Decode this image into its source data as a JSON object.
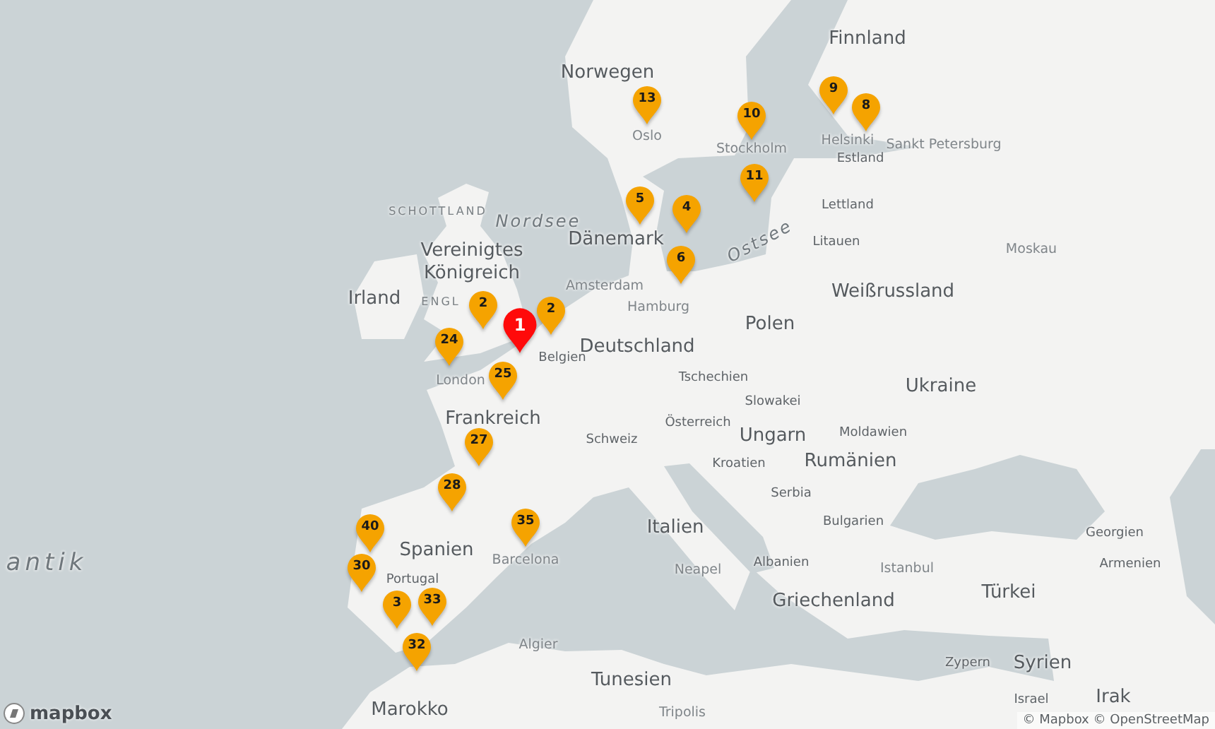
{
  "map": {
    "labels": [
      {
        "text": "Finnland",
        "kind": "country"
      },
      {
        "text": "Norwegen",
        "kind": "country"
      },
      {
        "text": "Oslo",
        "kind": "city"
      },
      {
        "text": "Stockholm",
        "kind": "city"
      },
      {
        "text": "Helsinki",
        "kind": "city"
      },
      {
        "text": "Sankt Petersburg",
        "kind": "city"
      },
      {
        "text": "Estland",
        "kind": "minor"
      },
      {
        "text": "Lettland",
        "kind": "minor"
      },
      {
        "text": "Litauen",
        "kind": "minor"
      },
      {
        "text": "Moskau",
        "kind": "city"
      },
      {
        "text": "SCHOTTLAND",
        "kind": "region"
      },
      {
        "text": "Nordsee",
        "kind": "sea"
      },
      {
        "text": "Ostsee",
        "kind": "sea"
      },
      {
        "text": "Dänemark",
        "kind": "country"
      },
      {
        "text": "Vereinigtes Königreich",
        "kind": "country"
      },
      {
        "text": "Irland",
        "kind": "country"
      },
      {
        "text": "ENGL",
        "kind": "region"
      },
      {
        "text": "Amsterdam",
        "kind": "city"
      },
      {
        "text": "Hamburg",
        "kind": "city"
      },
      {
        "text": "London",
        "kind": "city"
      },
      {
        "text": "Polen",
        "kind": "country"
      },
      {
        "text": "Weißrussland",
        "kind": "country"
      },
      {
        "text": "Deutschland",
        "kind": "country"
      },
      {
        "text": "Belgien",
        "kind": "minor"
      },
      {
        "text": "Tschechien",
        "kind": "minor"
      },
      {
        "text": "Ukraine",
        "kind": "country"
      },
      {
        "text": "Slowakei",
        "kind": "minor"
      },
      {
        "text": "Frankreich",
        "kind": "country"
      },
      {
        "text": "Österreich",
        "kind": "minor"
      },
      {
        "text": "Moldawien",
        "kind": "minor"
      },
      {
        "text": "Schweiz",
        "kind": "minor"
      },
      {
        "text": "Ungarn",
        "kind": "country"
      },
      {
        "text": "Rumänien",
        "kind": "country"
      },
      {
        "text": "Kroatien",
        "kind": "minor"
      },
      {
        "text": "Serbia",
        "kind": "minor"
      },
      {
        "text": "Bulgarien",
        "kind": "minor"
      },
      {
        "text": "Italien",
        "kind": "country"
      },
      {
        "text": "Spanien",
        "kind": "country"
      },
      {
        "text": "Georgien",
        "kind": "minor"
      },
      {
        "text": "antik",
        "kind": "ocean"
      },
      {
        "text": "Barcelona",
        "kind": "city"
      },
      {
        "text": "Albanien",
        "kind": "minor"
      },
      {
        "text": "Armenien",
        "kind": "minor"
      },
      {
        "text": "Neapel",
        "kind": "city"
      },
      {
        "text": "Istanbul",
        "kind": "city"
      },
      {
        "text": "Portugal",
        "kind": "minor"
      },
      {
        "text": "Türkei",
        "kind": "country"
      },
      {
        "text": "Griechenland",
        "kind": "country"
      },
      {
        "text": "Algier",
        "kind": "city"
      },
      {
        "text": "Syrien",
        "kind": "country"
      },
      {
        "text": "Zypern",
        "kind": "minor"
      },
      {
        "text": "Tunesien",
        "kind": "country"
      },
      {
        "text": "Irak",
        "kind": "country"
      },
      {
        "text": "Marokko",
        "kind": "country"
      },
      {
        "text": "Tripolis",
        "kind": "city"
      },
      {
        "text": "Israel",
        "kind": "minor"
      }
    ],
    "pins": [
      {
        "label": "13",
        "selected": false
      },
      {
        "label": "10",
        "selected": false
      },
      {
        "label": "11",
        "selected": false
      },
      {
        "label": "9",
        "selected": false
      },
      {
        "label": "8",
        "selected": false
      },
      {
        "label": "5",
        "selected": false
      },
      {
        "label": "4",
        "selected": false
      },
      {
        "label": "6",
        "selected": false
      },
      {
        "label": "2",
        "selected": false
      },
      {
        "label": "24",
        "selected": false
      },
      {
        "label": "2",
        "selected": false
      },
      {
        "label": "1",
        "selected": true
      },
      {
        "label": "25",
        "selected": false
      },
      {
        "label": "27",
        "selected": false
      },
      {
        "label": "28",
        "selected": false
      },
      {
        "label": "35",
        "selected": false
      },
      {
        "label": "40",
        "selected": false
      },
      {
        "label": "30",
        "selected": false
      },
      {
        "label": "3",
        "selected": false
      },
      {
        "label": "33",
        "selected": false
      },
      {
        "label": "32",
        "selected": false
      }
    ]
  },
  "logo": {
    "text": "mapbox"
  },
  "attribution": "© Mapbox © OpenStreetMap"
}
